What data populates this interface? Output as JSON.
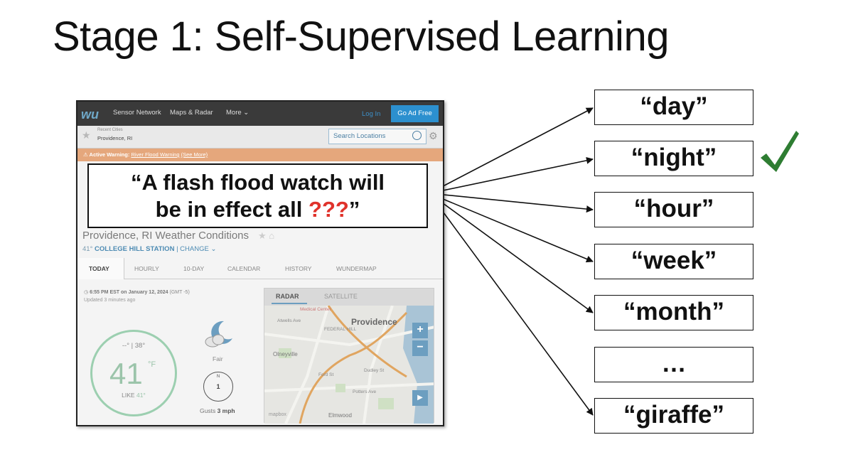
{
  "title": "Stage 1: Self-Supervised Learning",
  "callout": {
    "line1": "“A flash flood watch will",
    "line2_prefix": "be in effect all ",
    "mask": "???",
    "line2_suffix": "”"
  },
  "answers": [
    "“day”",
    "“night”",
    "“hour”",
    "“week”",
    "“month”",
    "…",
    "“giraffe”"
  ],
  "correct_answer": "“night”",
  "colors": {
    "mask": "#e0322b",
    "check": "#2e7d32",
    "accent": "#2c90cf"
  },
  "screenshot": {
    "logo": "wu",
    "nav": [
      "Sensor Network",
      "Maps & Radar",
      "More ⌄"
    ],
    "login": "Log In",
    "go_ad_free": "Go Ad Free",
    "recent_label": "Recent Cities",
    "recent_city": "Providence, RI",
    "search_placeholder": "Search Locations",
    "warning_label": "⚠ Active Warning:",
    "warning_link": "River Flood Warning",
    "warning_more": "(See More)",
    "conditions_title": "Providence, RI Weather Conditions",
    "station_temp": "41°",
    "station": "COLLEGE HILL STATION",
    "station_change": "| CHANGE ⌄",
    "tabs": [
      "TODAY",
      "HOURLY",
      "10-DAY",
      "CALENDAR",
      "HISTORY",
      "WUNDERMAP"
    ],
    "timestamp": "6:55 PM EST on January 12, 2024",
    "timestamp_tz": "(GMT -5)",
    "updated": "Updated 3 minutes ago",
    "hi_lo": "--° | 38°",
    "temperature": "41",
    "unit": "°F",
    "feels_like_label": "LIKE",
    "feels_like": "41°",
    "condition": "Fair",
    "wind_dir": "N",
    "wind_speed": "1",
    "gusts_label": "Gusts",
    "gusts": "3 mph",
    "map_tabs": [
      "RADAR",
      "SATELLITE"
    ],
    "map_city": "Providence",
    "map_labels": [
      "Medical Center",
      "Atwells Ave",
      "FEDERAL HILL",
      "Olneyville",
      "Dudley St",
      "Ford St",
      "Potters Ave",
      "Elmwood",
      "mapbox"
    ]
  }
}
